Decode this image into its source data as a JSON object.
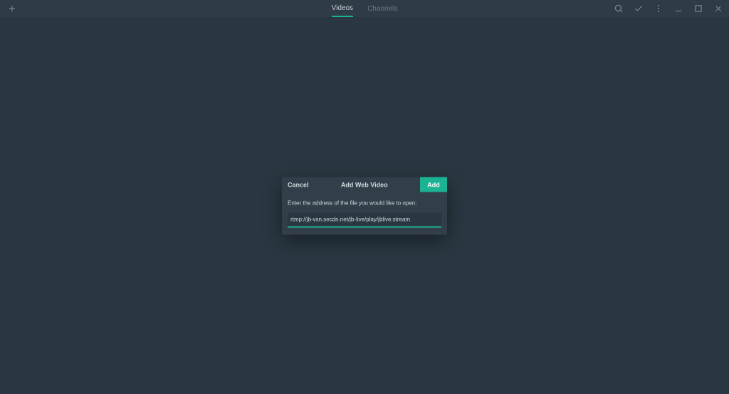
{
  "topbar": {
    "tabs": [
      {
        "label": "Videos",
        "active": true
      },
      {
        "label": "Channels",
        "active": false
      }
    ]
  },
  "modal": {
    "cancel_label": "Cancel",
    "title": "Add Web Video",
    "add_label": "Add",
    "prompt": "Enter the address of the file you would like to open:",
    "url_value": "rtmp://jb-vsn.secdn.net/jb-live/play/jblive.stream"
  },
  "colors": {
    "accent": "#1bb394",
    "bg": "#2a3742",
    "panel": "#323f4a",
    "topbar": "#2f3c47"
  }
}
